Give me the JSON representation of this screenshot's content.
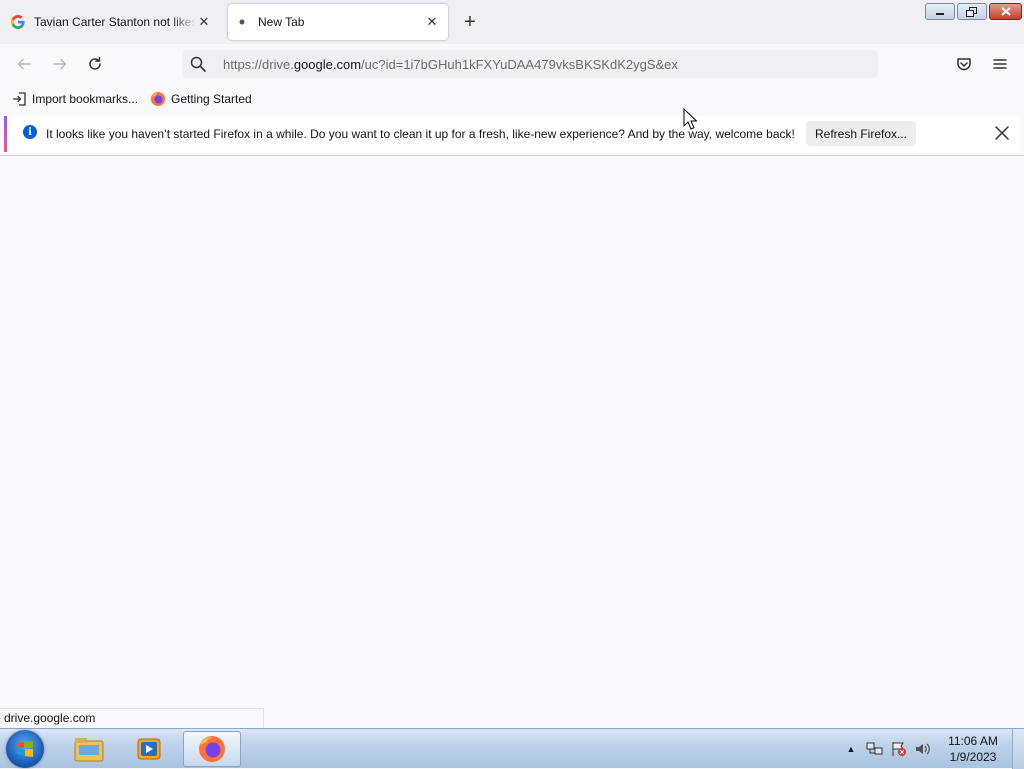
{
  "tabs": [
    {
      "title": "Tavian Carter Stanton not likes",
      "favicon": "google-g-icon",
      "active": false
    },
    {
      "title": "New Tab",
      "favicon": "dot-icon",
      "active": true
    }
  ],
  "window_controls": {
    "minimize": "minimize-icon",
    "restore": "restore-icon",
    "close": "close-icon"
  },
  "urlbar": {
    "prefix": "https://drive.",
    "domain": "google.com",
    "suffix": "/uc?id=1i7bGHuh1kFXYuDAA479vksBKSKdK2ygS&ex"
  },
  "bookmarks": [
    {
      "label": "Import bookmarks...",
      "icon": "import-icon"
    },
    {
      "label": "Getting Started",
      "icon": "firefox-icon"
    }
  ],
  "notification": {
    "message": "It looks like you haven’t started Firefox in a while. Do you want to clean it up for a fresh, like-new experience? And by the way, welcome back!",
    "button": "Refresh Firefox..."
  },
  "status_bar": {
    "text": "drive.google.com"
  },
  "taskbar": {
    "items": [
      "windows-explorer-icon",
      "media-player-icon",
      "firefox-icon"
    ],
    "clock": {
      "time": "11:06 AM",
      "date": "1/9/2023"
    }
  },
  "colors": {
    "accent": "#0060df",
    "notification_gradient_top": "#9059ff",
    "notification_gradient_bottom": "#ff4aa2"
  }
}
